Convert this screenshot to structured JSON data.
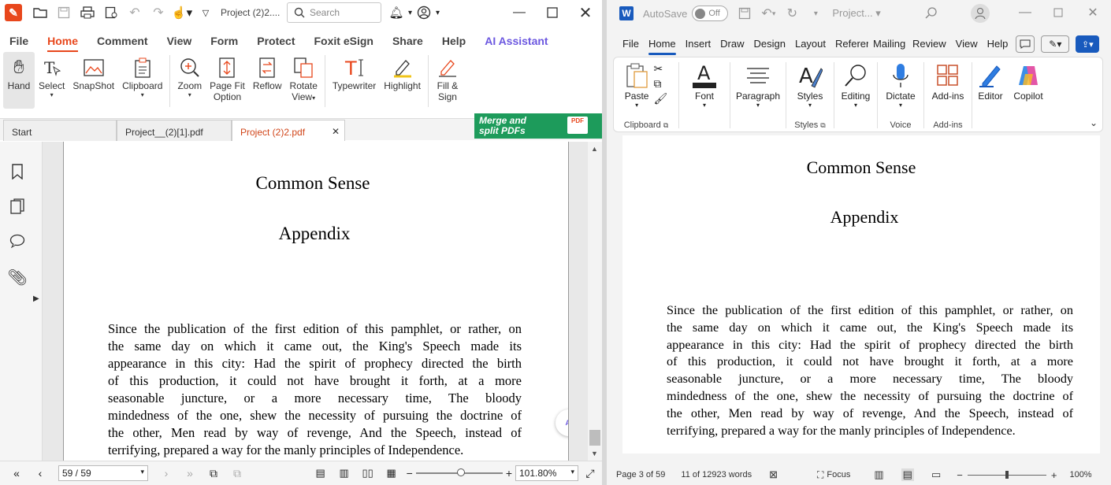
{
  "foxit": {
    "file_name": "Project  (2)2....",
    "search_placeholder": "Search",
    "menu": [
      "File",
      "Home",
      "Comment",
      "View",
      "Form",
      "Protect",
      "Foxit eSign",
      "Share",
      "Help",
      "AI Assistant"
    ],
    "tools": {
      "hand": "Hand",
      "select": "Select",
      "snapshot": "SnapShot",
      "clipboard": "Clipboard",
      "zoom": "Zoom",
      "page_fit_1": "Page Fit",
      "page_fit_2": "Option",
      "reflow": "Reflow",
      "rotate_1": "Rotate",
      "rotate_2": "View",
      "typewriter": "Typewriter",
      "highlight": "Highlight",
      "fill_1": "Fill &",
      "fill_2": "Sign"
    },
    "tabs": [
      "Start",
      "Project__(2)[1].pdf",
      "Project  (2)2.pdf"
    ],
    "merge_banner_1": "Merge and",
    "merge_banner_2": "split PDFs",
    "pdf_badge": "PDF",
    "ai_badge": "AI",
    "doc_title": "Common Sense",
    "doc_subtitle": "Appendix",
    "doc_lines": [
      "Since the publication of the first edition of this pamphlet, or rather, on",
      "the same day on which it came out, the King's Speech made its",
      "appearance in this city: Had the spirit of prophecy directed the birth",
      "of this production, it could not have brought it forth, at a more",
      "seasonable juncture, or a more necessary time, The bloody",
      "mindedness of the one, shew the necessity of pursuing the doctrine of",
      "the other, Men read by way of revenge, And the Speech, instead of",
      "terrifying, prepared a way for the manly principles of Independence."
    ],
    "page_indicator": "59 / 59",
    "zoom_level": "101.80%"
  },
  "word": {
    "autosave_label": "AutoSave",
    "autosave_state": "Off",
    "file_name": "Project...",
    "menu": [
      "File",
      "Home",
      "Insert",
      "Draw",
      "Design",
      "Layout",
      "Referer",
      "Mailing",
      "Review",
      "View",
      "Help"
    ],
    "ribbon": {
      "paste": "Paste",
      "clipboard_group": "Clipboard",
      "font": "Font",
      "paragraph": "Paragraph",
      "styles": "Styles",
      "styles_group": "Styles",
      "editing": "Editing",
      "dictate": "Dictate",
      "voice_group": "Voice",
      "addins": "Add-ins",
      "addins_group": "Add-ins",
      "editor": "Editor",
      "copilot": "Copilot"
    },
    "doc_title": "Common Sense",
    "doc_subtitle": "Appendix",
    "doc_lines": [
      "Since the publication of the first edition of this pamphlet, or rather, on",
      "the same day on which it came out, the King's Speech made its",
      "appearance in this city: Had the spirit of prophecy directed the birth",
      "of this production, it could not have brought it forth, at a more",
      "seasonable juncture, or a more necessary time, The bloody",
      "mindedness of the one, shew the necessity of pursuing the doctrine of",
      "the other, Men read by way of revenge, And the Speech, instead of",
      "terrifying, prepared a way for the manly principles of Independence."
    ],
    "status": {
      "page": "Page 3 of 59",
      "words": "11 of 12923 words",
      "focus": "Focus",
      "zoom": "100%"
    }
  },
  "colors": {
    "foxit_accent": "#e8471c",
    "ai_purple": "#6c58e0",
    "merge_green": "#1d9b5b",
    "word_blue": "#185abd"
  }
}
